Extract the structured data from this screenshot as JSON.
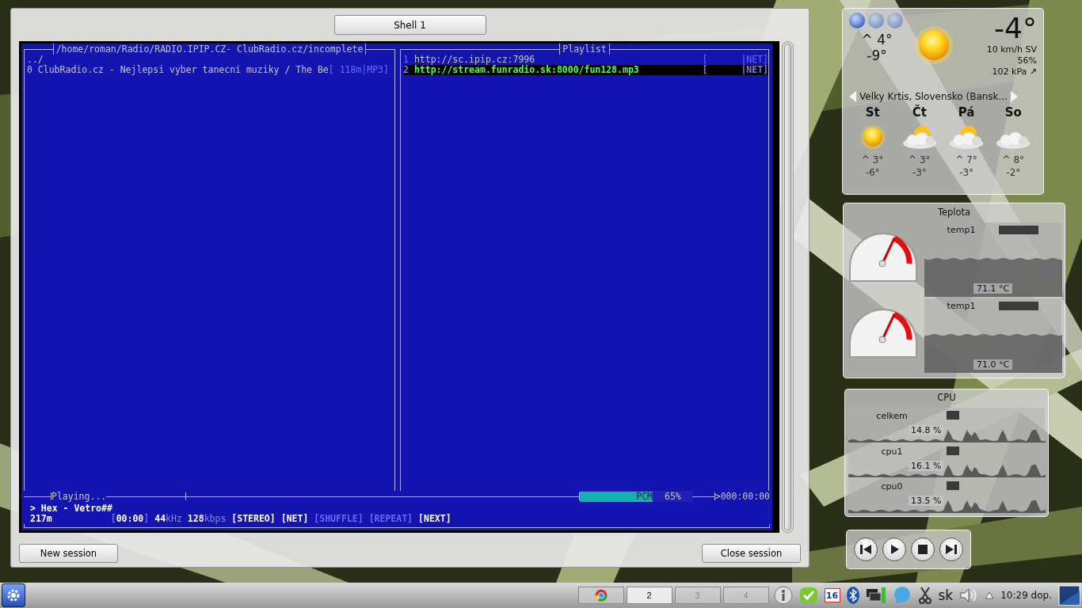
{
  "window": {
    "tab": "Shell 1",
    "new_session": "New session",
    "close_session": "Close session"
  },
  "terminal": {
    "files": {
      "title": "/home/roman/Radio/RADIO.IPIP.CZ- ClubRadio.cz/incomplete",
      "entries": [
        {
          "name": "../"
        },
        {
          "name": "0 ClubRadio.cz - Nejlepsi vyber tanecni muziky / The Be",
          "info": "[ 118m|MP3]"
        }
      ]
    },
    "playlist": {
      "title": "Playlist",
      "items": [
        {
          "number": "1",
          "url": "http://sc.ipip.cz:7996",
          "tag_open": "[",
          "tag_close": "|NET]",
          "selected": false
        },
        {
          "number": "2",
          "url": "http://stream.funradio.sk:8000/fun128.mp3",
          "tag_open": "[",
          "tag_close": "|NET]",
          "selected": true
        }
      ]
    },
    "status": "Playing...",
    "mixer": {
      "label": "PCM",
      "level": 0.65,
      "reading": "65%"
    },
    "time": ">000:00:00",
    "now_playing": "> Hex - Vetro##",
    "info": [
      {
        "kind": "value",
        "text": "217m"
      },
      {
        "kind": "value",
        "prefix": "[",
        "text": "00:00",
        "suffix": "]"
      },
      {
        "kind": "value",
        "text": "44",
        "suffix": "kHz"
      },
      {
        "kind": "value",
        "text": "128",
        "suffix": "kbps"
      },
      {
        "kind": "flag",
        "text": "[STEREO]",
        "on": true
      },
      {
        "kind": "flag",
        "text": "[NET]",
        "on": true
      },
      {
        "kind": "flag",
        "text": "[SHUFFLE]",
        "on": false
      },
      {
        "kind": "flag",
        "text": "[REPEAT]",
        "on": false
      },
      {
        "kind": "flag",
        "text": "[NEXT]",
        "on": true
      }
    ]
  },
  "weather": {
    "locations": [
      {
        "selected": true
      },
      {
        "selected": false
      },
      {
        "selected": false
      }
    ],
    "high": "^ 4°",
    "low": "-9°",
    "temperature": "-4°",
    "wind": "10 km/h SV",
    "humidity": "56%",
    "pressure": "102 kPa ↗",
    "kind": "sun",
    "location": "Velky Krtis, Slovensko (Bansk...",
    "forecast": [
      {
        "day": "St",
        "kind": "sun",
        "high": "^ 3°",
        "low": "-6°"
      },
      {
        "day": "Čt",
        "kind": "partly",
        "high": "^ 3°",
        "low": "-3°"
      },
      {
        "day": "Pá",
        "kind": "partly",
        "high": "^ 7°",
        "low": "-3°"
      },
      {
        "day": "So",
        "kind": "cloud",
        "high": "^ 8°",
        "low": "-2°"
      }
    ]
  },
  "temperature": {
    "title": "Teplota",
    "sensors": [
      {
        "name": "temp1",
        "reading": "71.1 °C",
        "level": 0.64
      },
      {
        "name": "temp1",
        "reading": "71.0 °C",
        "level": 0.64
      }
    ]
  },
  "cpu": {
    "title": "CPU",
    "rows": [
      {
        "name": "celkem",
        "reading": "14.8 %"
      },
      {
        "name": "cpu1",
        "reading": "16.1 %"
      },
      {
        "name": "cpu0",
        "reading": "13.5 %"
      }
    ]
  },
  "taskbar": {
    "desktops": [
      {
        "kind": "app",
        "selected": false
      },
      {
        "kind": "number",
        "label": "2",
        "selected": true
      },
      {
        "kind": "number",
        "label": "3",
        "selected": false
      },
      {
        "kind": "number",
        "label": "4",
        "selected": false
      }
    ],
    "calendar_day": "16",
    "keyboard": "sk",
    "clock": "10:29 dop."
  }
}
